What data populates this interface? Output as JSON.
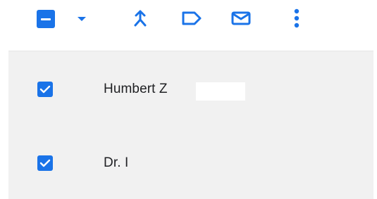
{
  "colors": {
    "accent": "#1a73e8",
    "list_background": "#f1f1f1",
    "text": "#202124"
  },
  "toolbar": {
    "select_all": {
      "state": "indeterminate",
      "icon": "minus-checkbox-icon"
    },
    "select_menu": {
      "icon": "caret-down-icon"
    },
    "actions": [
      {
        "icon": "merge-icon"
      },
      {
        "icon": "label-icon"
      },
      {
        "icon": "mail-icon"
      },
      {
        "icon": "more-vert-icon"
      }
    ]
  },
  "contacts": [
    {
      "name": "Humbert Z",
      "checked": true
    },
    {
      "name": "Dr. I",
      "checked": true
    }
  ]
}
